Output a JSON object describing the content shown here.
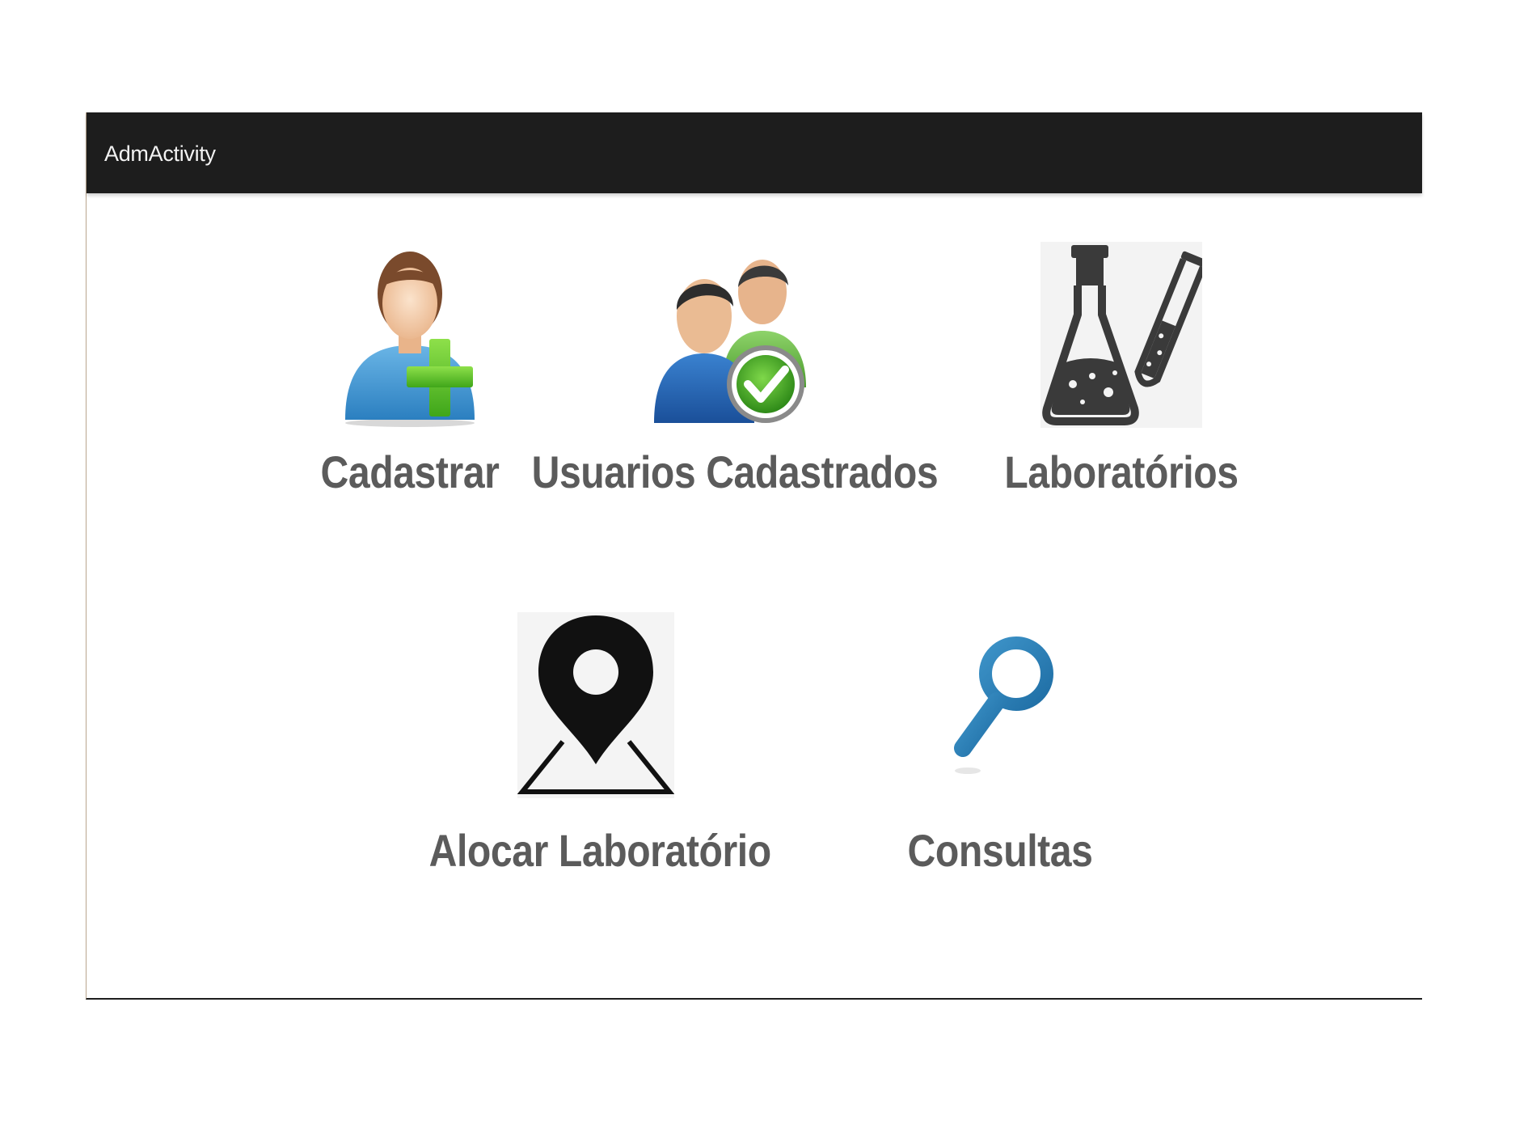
{
  "window": {
    "title": "AdmActivity"
  },
  "menu": {
    "items": [
      {
        "id": "cadastrar",
        "label": "Cadastrar",
        "icon": "add-user-icon"
      },
      {
        "id": "usuarios",
        "label": "Usuarios Cadastrados",
        "icon": "registered-users-icon"
      },
      {
        "id": "laboratorios",
        "label": "Laboratórios",
        "icon": "laboratory-flask-icon"
      },
      {
        "id": "alocar",
        "label": "Alocar Laboratório",
        "icon": "map-pin-icon"
      },
      {
        "id": "consultas",
        "label": "Consultas",
        "icon": "search-icon"
      }
    ]
  },
  "colors": {
    "action_bar": "#1d1d1d",
    "label_text": "#5b5b5b",
    "green_accent": "#5cbf2a",
    "blue_accent": "#2f7fb6"
  }
}
